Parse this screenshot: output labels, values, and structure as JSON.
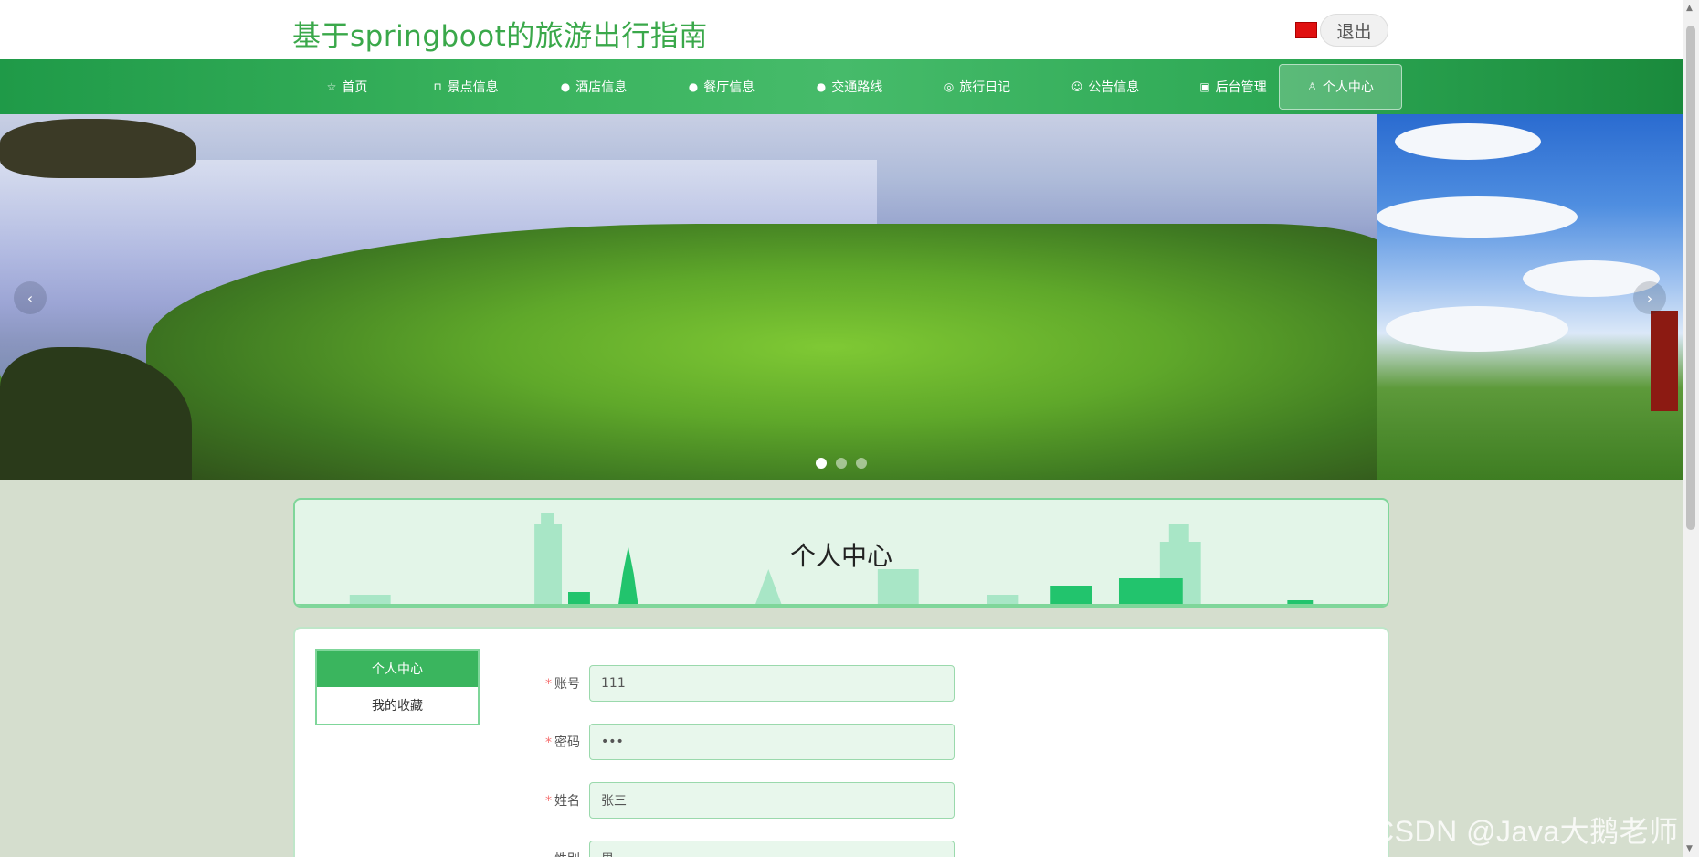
{
  "header": {
    "site_title": "基于springboot的旅游出行指南",
    "logout_label": "退出"
  },
  "nav": {
    "items": [
      {
        "label": "首页",
        "icon": "star-icon"
      },
      {
        "label": "景点信息",
        "icon": "shopping-bag-icon"
      },
      {
        "label": "酒店信息",
        "icon": "info-circle-icon"
      },
      {
        "label": "餐厅信息",
        "icon": "question-circle-icon"
      },
      {
        "label": "交通路线",
        "icon": "info-icon"
      },
      {
        "label": "旅行日记",
        "icon": "compass-icon"
      },
      {
        "label": "公告信息",
        "icon": "smile-icon"
      },
      {
        "label": "后台管理",
        "icon": "shop-icon"
      },
      {
        "label": "个人中心",
        "icon": "user-icon",
        "active": true
      }
    ]
  },
  "banner": {
    "slide_count": 3,
    "active_slide": 1,
    "prev_glyph": "‹",
    "next_glyph": "›"
  },
  "page": {
    "title": "个人中心"
  },
  "side_menu": {
    "items": [
      {
        "label": "个人中心",
        "active": true
      },
      {
        "label": "我的收藏",
        "active": false
      }
    ]
  },
  "form": {
    "fields": [
      {
        "label": "账号",
        "required": true,
        "value": "111"
      },
      {
        "label": "密码",
        "required": true,
        "value": "•••"
      },
      {
        "label": "姓名",
        "required": true,
        "value": "张三"
      },
      {
        "label": "性别",
        "required": false,
        "value": "男"
      }
    ]
  },
  "watermark": "CSDN @Java大鹅老师",
  "colors": {
    "brand_green": "#3aa84a",
    "nav_green": "#39b35d",
    "active_menu": "#3ab55e",
    "input_bg": "#e8f7ec",
    "required_star": "#f56c6c"
  }
}
